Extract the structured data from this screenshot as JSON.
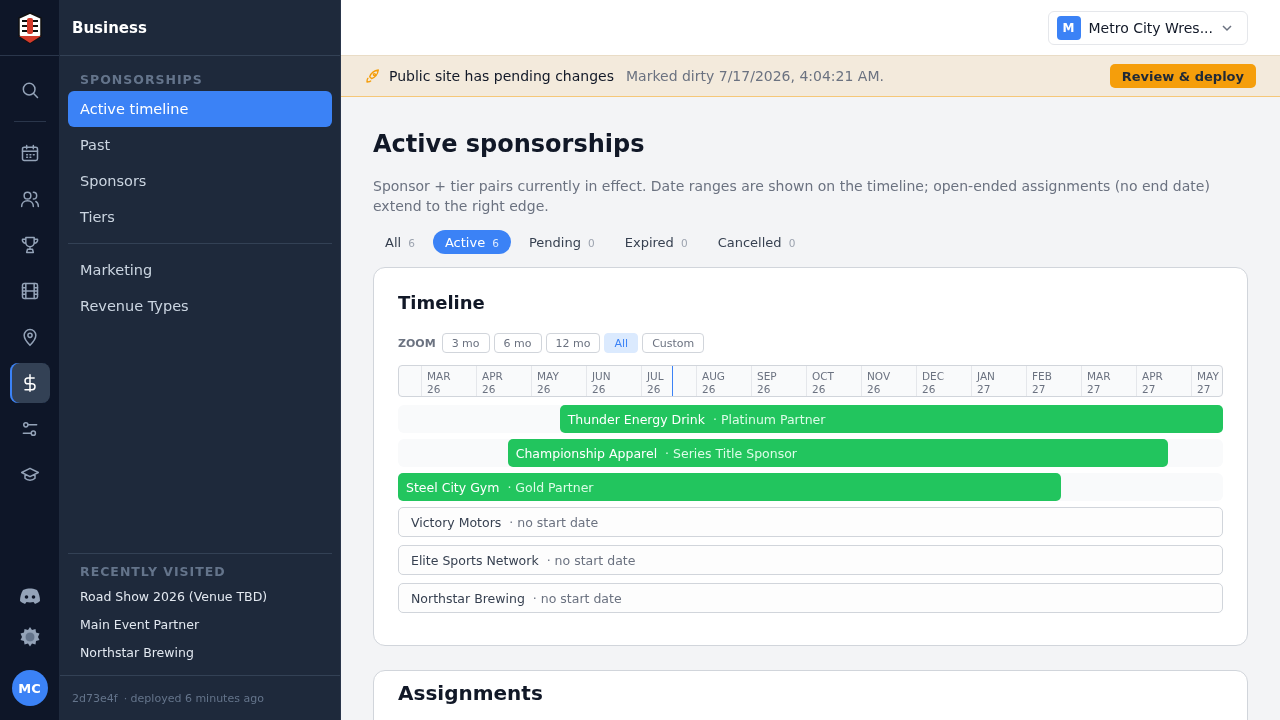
{
  "rail": {
    "items": [
      {
        "kind": "search",
        "selected": false
      },
      {
        "kind": "calendar",
        "selected": false
      },
      {
        "kind": "people",
        "selected": false
      },
      {
        "kind": "trophy",
        "selected": false
      },
      {
        "kind": "film",
        "selected": false
      },
      {
        "kind": "pin",
        "selected": false
      },
      {
        "kind": "dollar",
        "selected": true
      },
      {
        "kind": "sliders",
        "selected": false
      },
      {
        "kind": "cap",
        "selected": false
      }
    ],
    "bottom": [
      {
        "kind": "chat"
      },
      {
        "kind": "sun"
      }
    ],
    "avatar": "MC"
  },
  "sidebar": {
    "title": "Business",
    "section": "SPONSORSHIPS",
    "items": [
      {
        "label": "Active timeline",
        "selected": true
      },
      {
        "label": "Past",
        "selected": false
      },
      {
        "label": "Sponsors",
        "selected": false
      },
      {
        "label": "Tiers",
        "selected": false
      }
    ],
    "items2": [
      {
        "label": "Marketing",
        "selected": false
      },
      {
        "label": "Revenue Types",
        "selected": false
      }
    ],
    "recent_title": "RECENTLY VISITED",
    "recent": [
      "Road Show 2026 (Venue TBD)",
      "Main Event Partner",
      "Northstar Brewing"
    ],
    "footer": {
      "commit": "2d73e4f",
      "deployed": "· deployed 6 minutes ago"
    }
  },
  "org": {
    "initial": "M",
    "name": "Metro City Wres..."
  },
  "banner": {
    "title": "Public site has pending changes",
    "detail": "Marked dirty 7/17/2026, 4:04:21 AM.",
    "button": "Review & deploy"
  },
  "page": {
    "title": "Active sponsorships",
    "description": "Sponsor + tier pairs currently in effect. Date ranges are shown on the timeline; open-ended assignments (no end date) extend to the right edge."
  },
  "filters": [
    {
      "label": "All",
      "count": "6",
      "selected": false
    },
    {
      "label": "Active",
      "count": "6",
      "selected": true
    },
    {
      "label": "Pending",
      "count": "0",
      "selected": false
    },
    {
      "label": "Expired",
      "count": "0",
      "selected": false
    },
    {
      "label": "Cancelled",
      "count": "0",
      "selected": false
    }
  ],
  "timeline": {
    "title": "Timeline",
    "zoom_label": "ZOOM",
    "zoom": [
      {
        "label": "3 mo",
        "selected": false
      },
      {
        "label": "6 mo",
        "selected": false
      },
      {
        "label": "12 mo",
        "selected": false
      },
      {
        "label": "All",
        "selected": true
      },
      {
        "label": "Custom",
        "selected": false
      }
    ],
    "months": [
      {
        "month": "MAR",
        "year": "26"
      },
      {
        "month": "APR",
        "year": "26"
      },
      {
        "month": "MAY",
        "year": "26"
      },
      {
        "month": "JUN",
        "year": "26"
      },
      {
        "month": "JUL",
        "year": "26"
      },
      {
        "month": "AUG",
        "year": "26"
      },
      {
        "month": "SEP",
        "year": "26"
      },
      {
        "month": "OCT",
        "year": "26"
      },
      {
        "month": "NOV",
        "year": "26"
      },
      {
        "month": "DEC",
        "year": "26"
      },
      {
        "month": "JAN",
        "year": "27"
      },
      {
        "month": "FEB",
        "year": "27"
      },
      {
        "month": "MAR",
        "year": "27"
      },
      {
        "month": "APR",
        "year": "27"
      },
      {
        "month": "MAY",
        "year": "27"
      }
    ],
    "rows": [
      {
        "kind": "bar",
        "sponsor": "Thunder Energy Drink",
        "tier": "· Platinum Partner"
      },
      {
        "kind": "bar",
        "sponsor": "Championship Apparel",
        "tier": "· Series Title Sponsor"
      },
      {
        "kind": "bar",
        "sponsor": "Steel City Gym",
        "tier": "· Gold Partner"
      },
      {
        "kind": "undated",
        "sponsor": "Victory Motors",
        "tier": "· no start date"
      },
      {
        "kind": "undated",
        "sponsor": "Elite Sports Network",
        "tier": "· no start date"
      },
      {
        "kind": "undated",
        "sponsor": "Northstar Brewing",
        "tier": "· no start date"
      }
    ]
  },
  "assignments": {
    "title": "Assignments"
  }
}
